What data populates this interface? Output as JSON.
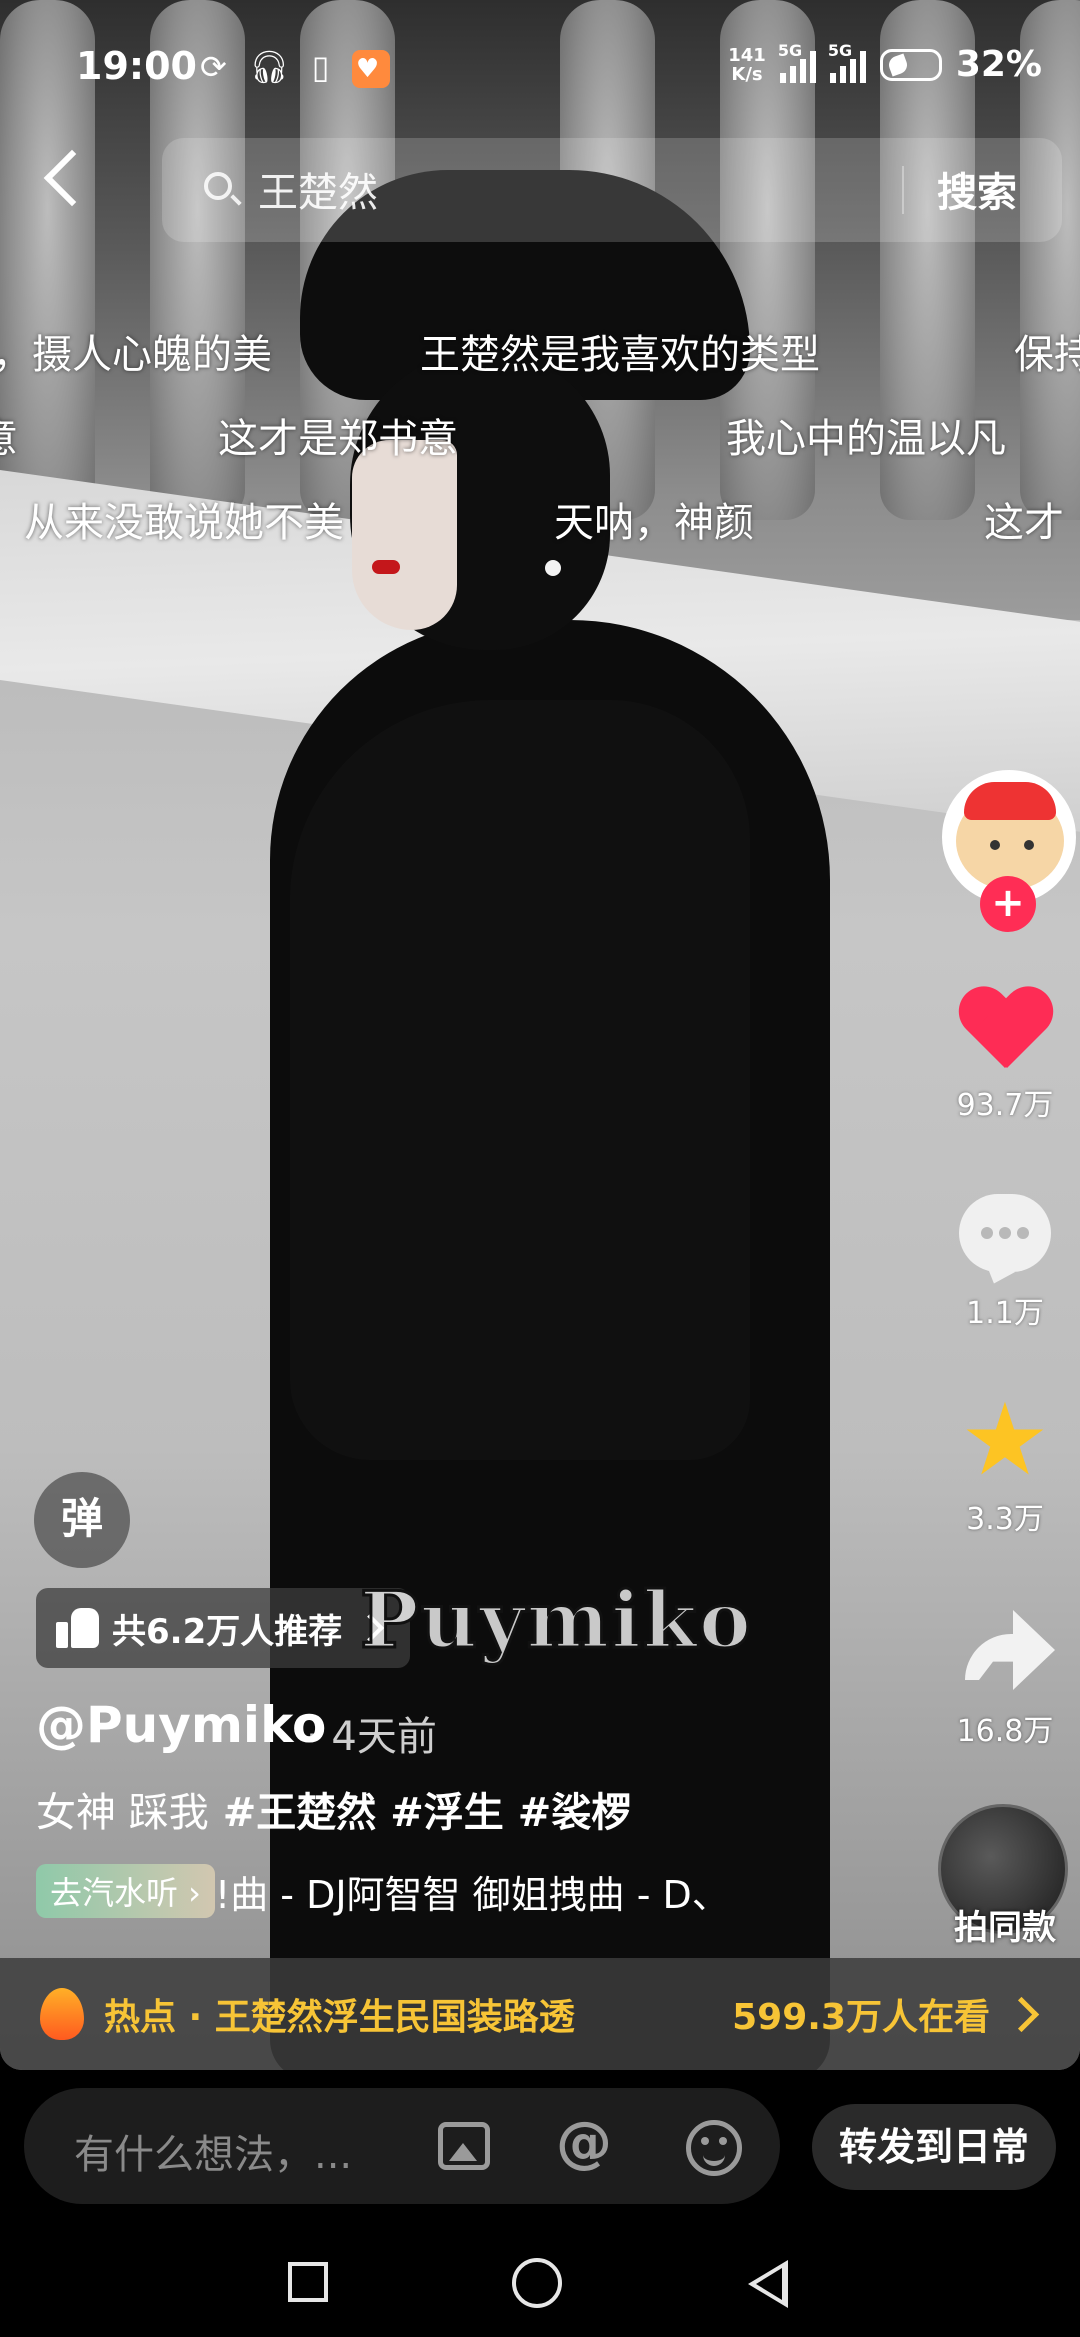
{
  "status_bar": {
    "time": "19:00",
    "net_speed_value": "141",
    "net_speed_unit": "K/s",
    "sim1": "5G",
    "sim2": "5G",
    "battery": "32%"
  },
  "search": {
    "query": "王楚然",
    "button": "搜索"
  },
  "danmaku": [
    "，摄人心魄的美",
    "王楚然是我喜欢的类型",
    "保持",
    "意",
    "这才是郑书意",
    "我心中的温以凡",
    "从来没敢说她不美",
    "天呐，神颜",
    "这才"
  ],
  "rail": {
    "likes": "93.7万",
    "comments": "1.1万",
    "favorites": "3.3万",
    "shares": "16.8万",
    "same_style": "拍同款",
    "follow_symbol": "+"
  },
  "video_info": {
    "danmaku_toggle": "弹",
    "recommend": "共6.2万人推荐",
    "watermark": "Puymiko",
    "author": "@Puymiko",
    "time_ago": "· 4天前",
    "caption_text": "女神 踩我",
    "hashtags": [
      "#王楚然",
      "#浮生",
      "#裟椤"
    ],
    "music_chip": "去汽水听 ›",
    "music": "!曲 - DJ阿智智    御姐拽曲 - D、"
  },
  "hot": {
    "text": "热点 · 王楚然浮生民国装路透",
    "count": "599.3万人在看"
  },
  "bottom": {
    "comment_placeholder": "有什么想法，...",
    "at_symbol": "@",
    "repost": "转发到日常"
  },
  "colors": {
    "like": "#fe2c55",
    "star": "#fdc423",
    "hot": "#f7c436"
  }
}
